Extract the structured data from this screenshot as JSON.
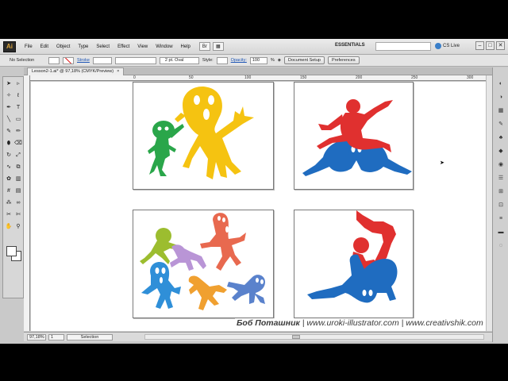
{
  "app": {
    "logo": "Ai",
    "workspace": "ESSENTIALS",
    "cs_live": "CS Live"
  },
  "menu": [
    "File",
    "Edit",
    "Object",
    "Type",
    "Select",
    "Effect",
    "View",
    "Window",
    "Help"
  ],
  "bridge_buttons": [
    "Br",
    "▦"
  ],
  "window_controls": [
    "–",
    "□",
    "✕"
  ],
  "control_bar": {
    "selection": "No Selection",
    "stroke_label": "Stroke",
    "brush": "2 pt. Oval",
    "style_label": "Style:",
    "opacity_label": "Opacity:",
    "opacity_value": "100",
    "percent": "%",
    "doc_setup_button": "Document Setup",
    "preferences_button": "Preferences"
  },
  "document_tab": {
    "title": "Lesson2-1.ai* @ 97,18% (CMYK/Preview)",
    "close": "×"
  },
  "ruler": {
    "h_marks": [
      "0",
      "50",
      "100",
      "150",
      "200",
      "250",
      "300",
      "350",
      "400",
      "450"
    ]
  },
  "status_bar": {
    "zoom": "97,18%",
    "artboard": "1",
    "mode": "Selection"
  },
  "watermark": {
    "author": "Боб Поташник",
    "sep1": " | ",
    "site1": "www.uroki-illustrator.com",
    "sep2": " | ",
    "site2": "www.creativshik.com"
  },
  "colors": {
    "green": "#2aa64a",
    "yellow": "#f5c311",
    "red": "#e0302f",
    "blue": "#1f6cc0",
    "orange_red": "#e8694f",
    "lime": "#9cbd2f",
    "lilac": "#b995d6",
    "sky_blue": "#2f8fd8",
    "orange": "#f0a030",
    "periwinkle": "#5a82cc"
  },
  "tool_icons": [
    "selection-arrow-icon",
    "direct-selection-icon",
    "magic-wand-icon",
    "lasso-icon",
    "pen-icon",
    "type-icon",
    "line-icon",
    "rectangle-icon",
    "paintbrush-icon",
    "pencil-icon",
    "blob-brush-icon",
    "eraser-icon",
    "rotate-icon",
    "scale-icon",
    "warp-icon",
    "free-transform-icon",
    "symbol-sprayer-icon",
    "graph-icon",
    "mesh-icon",
    "gradient-icon",
    "eyedropper-icon",
    "blend-icon",
    "slice-icon",
    "scissors-icon",
    "hand-icon",
    "zoom-icon"
  ],
  "dock_icons": [
    "color-panel-icon",
    "color-guide-icon",
    "swatches-icon",
    "brushes-icon",
    "symbols-icon",
    "graphic-styles-icon",
    "appearance-icon",
    "layers-icon",
    "align-icon",
    "transform-icon",
    "stroke-panel-icon",
    "gradient-panel-icon",
    "transparency-icon"
  ]
}
